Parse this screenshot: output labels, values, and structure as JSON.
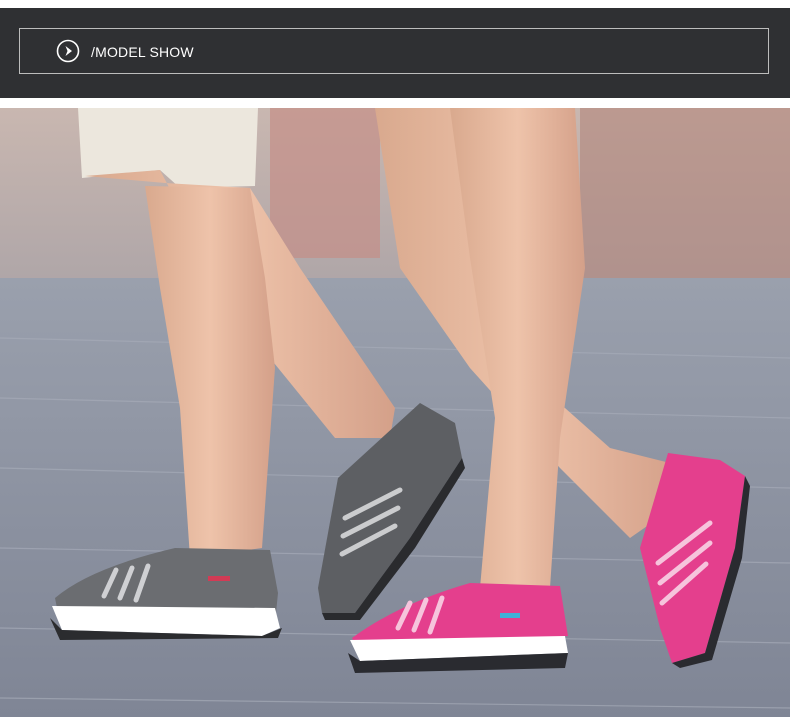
{
  "header": {
    "title": "/MODEL SHOW",
    "icon": "play-circle-icon"
  },
  "photo": {
    "subject": "couple-walking-in-sneakers",
    "colors": {
      "header_bg": "#2f3033",
      "shoe_gray": "#5e6064",
      "shoe_pink": "#e63a8c",
      "pavement": "#8b90a0"
    }
  }
}
